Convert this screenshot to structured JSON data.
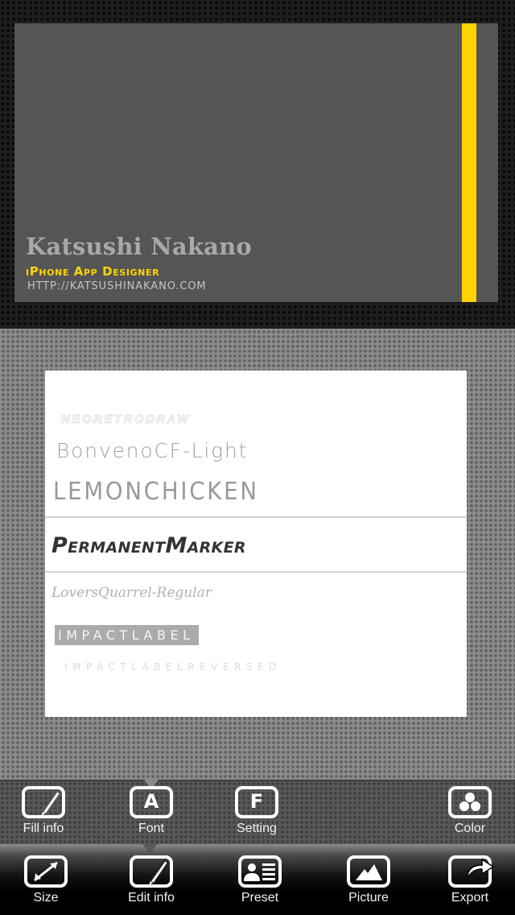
{
  "card": {
    "name": "Katsushi Nakano",
    "title": "iPhone App Designer",
    "url": "HTTP://KATSUSHINAKANO.COM",
    "background_color": "#555555",
    "accent_color": "#ffd400",
    "name_color": "#a9a9a9"
  },
  "font_picker": {
    "items": [
      {
        "label": ""
      },
      {
        "label": "NEORETRODRAW"
      },
      {
        "label": "BonvenoCF-Light"
      },
      {
        "label": "LEMONCHICKEN"
      },
      {
        "label": "PermanentMarker",
        "selected": true
      },
      {
        "label": "LoversQuarrel-Regular"
      },
      {
        "label": "IMPACTLABEL"
      },
      {
        "label": "IMPACTLABELREVERSED"
      },
      {
        "label": ""
      }
    ]
  },
  "toolbar_upper": {
    "items": [
      {
        "label": "Fill info",
        "icon": "pencil-box-icon"
      },
      {
        "label": "Font",
        "icon": "letter-a-icon",
        "glyph": "A",
        "active": true
      },
      {
        "label": "Setting",
        "icon": "letter-f-icon",
        "glyph": "F"
      },
      {
        "label": "Color",
        "icon": "color-circles-icon"
      }
    ]
  },
  "toolbar_lower": {
    "items": [
      {
        "label": "Size",
        "icon": "resize-arrows-icon"
      },
      {
        "label": "Edit info",
        "icon": "pencil-box-icon",
        "active": true
      },
      {
        "label": "Preset",
        "icon": "id-card-icon"
      },
      {
        "label": "Picture",
        "icon": "mountains-image-icon"
      },
      {
        "label": "Export",
        "icon": "share-export-icon"
      }
    ]
  }
}
